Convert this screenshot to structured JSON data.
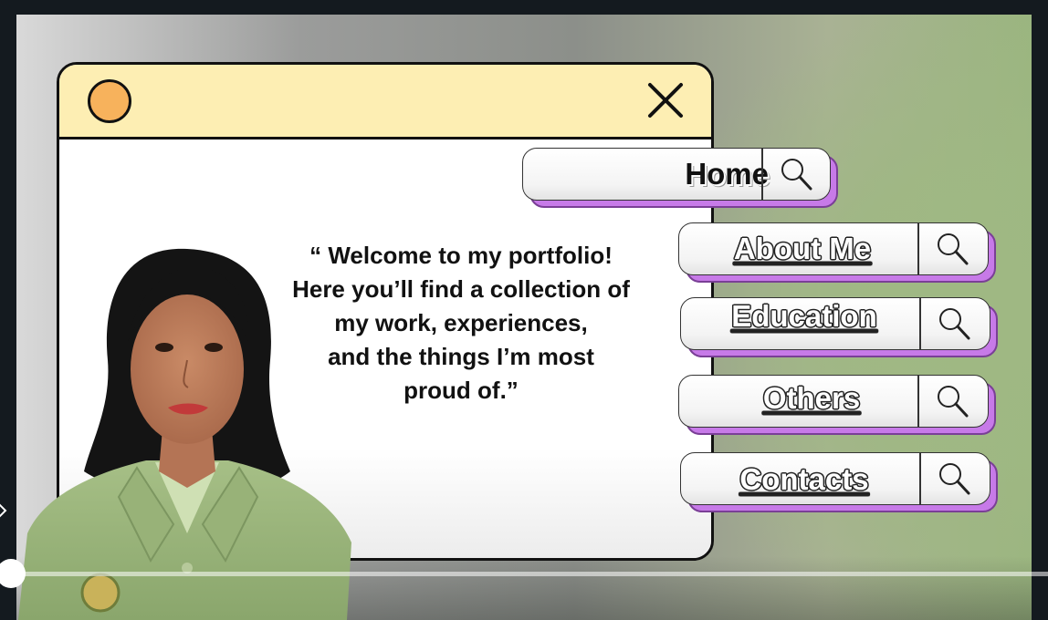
{
  "slide": {
    "quote_lines": [
      "“ Welcome to my portfolio!",
      "Here you’ll find a collection of",
      "my work, experiences,",
      "and the things I’m most",
      "proud of.”"
    ]
  },
  "window": {
    "dot_color": "#f7b25c",
    "bar_color": "#fdeeb3",
    "close_icon": "close-icon"
  },
  "nav": {
    "home": "Home",
    "about": "About Me",
    "education": "Education",
    "others": "Others",
    "contacts": "Contacts",
    "accent_color": "#c77ae8",
    "icon": "search-icon"
  },
  "player": {
    "progress": 0.0
  }
}
